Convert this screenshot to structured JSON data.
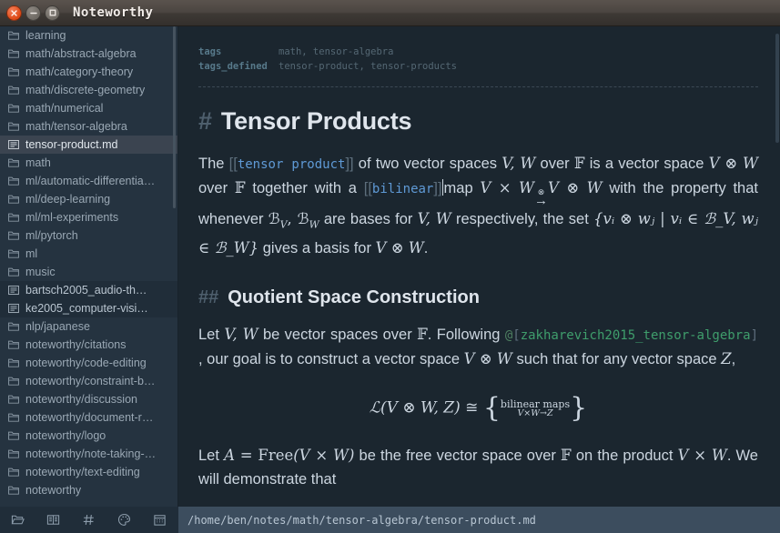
{
  "window": {
    "title": "Noteworthy",
    "controls": [
      {
        "name": "close",
        "glyph": "×"
      },
      {
        "name": "minimize",
        "glyph": "−"
      },
      {
        "name": "maximize",
        "glyph": "□"
      }
    ]
  },
  "sidebar": {
    "items": [
      {
        "label": "learning",
        "icon": "folder-icon",
        "type": "folder",
        "selected": false
      },
      {
        "label": "math/abstract-algebra",
        "icon": "folder-icon",
        "type": "folder",
        "selected": false
      },
      {
        "label": "math/category-theory",
        "icon": "folder-icon",
        "type": "folder",
        "selected": false
      },
      {
        "label": "math/discrete-geometry",
        "icon": "folder-icon",
        "type": "folder",
        "selected": false
      },
      {
        "label": "math/numerical",
        "icon": "folder-icon",
        "type": "folder",
        "selected": false
      },
      {
        "label": "math/tensor-algebra",
        "icon": "folder-icon",
        "type": "folder",
        "selected": false
      },
      {
        "label": "tensor-product.md",
        "icon": "note-icon",
        "type": "note",
        "selected": true
      },
      {
        "label": "math",
        "icon": "folder-icon",
        "type": "folder",
        "selected": false
      },
      {
        "label": "ml/automatic-differentia…",
        "icon": "folder-icon",
        "type": "folder",
        "selected": false
      },
      {
        "label": "ml/deep-learning",
        "icon": "folder-icon",
        "type": "folder",
        "selected": false
      },
      {
        "label": "ml/ml-experiments",
        "icon": "folder-icon",
        "type": "folder",
        "selected": false
      },
      {
        "label": "ml/pytorch",
        "icon": "folder-icon",
        "type": "folder",
        "selected": false
      },
      {
        "label": "ml",
        "icon": "folder-icon",
        "type": "folder",
        "selected": false
      },
      {
        "label": "music",
        "icon": "folder-icon",
        "type": "folder",
        "selected": false
      },
      {
        "label": "bartsch2005_audio-th…",
        "icon": "note-icon",
        "type": "note",
        "selected": false
      },
      {
        "label": "ke2005_computer-visi…",
        "icon": "note-icon",
        "type": "note",
        "selected": false
      },
      {
        "label": "nlp/japanese",
        "icon": "folder-icon",
        "type": "folder",
        "selected": false
      },
      {
        "label": "noteworthy/citations",
        "icon": "folder-icon",
        "type": "folder",
        "selected": false
      },
      {
        "label": "noteworthy/code-editing",
        "icon": "folder-icon",
        "type": "folder",
        "selected": false
      },
      {
        "label": "noteworthy/constraint-b…",
        "icon": "folder-icon",
        "type": "folder",
        "selected": false
      },
      {
        "label": "noteworthy/discussion",
        "icon": "folder-icon",
        "type": "folder",
        "selected": false
      },
      {
        "label": "noteworthy/document-r…",
        "icon": "folder-icon",
        "type": "folder",
        "selected": false
      },
      {
        "label": "noteworthy/logo",
        "icon": "folder-icon",
        "type": "folder",
        "selected": false
      },
      {
        "label": "noteworthy/note-taking-…",
        "icon": "folder-icon",
        "type": "folder",
        "selected": false
      },
      {
        "label": "noteworthy/text-editing",
        "icon": "folder-icon",
        "type": "folder",
        "selected": false
      },
      {
        "label": "noteworthy",
        "icon": "folder-icon",
        "type": "folder",
        "selected": false
      }
    ]
  },
  "document": {
    "frontmatter": [
      {
        "key": "tags",
        "value": "math, tensor-algebra"
      },
      {
        "key": "tags_defined",
        "value": "tensor-product, tensor-products"
      }
    ],
    "h1_marker": "#",
    "h1": "Tensor Products",
    "h2_marker": "##",
    "h2": "Quotient Space Construction",
    "p1": {
      "t1": "The ",
      "link1_open": "[[",
      "link1": "tensor product",
      "link1_close": "]]",
      "t2": " of two vector spaces ",
      "m1": "V, W",
      "t3": " over ",
      "m2": "𝔽",
      "t4": " is a vector space ",
      "m3": "V ⊗ W",
      "t5": " over ",
      "m4": "𝔽",
      "t6": " together with a ",
      "link2_open": "[[",
      "link2": "bilinear",
      "link2_close": "]]",
      "t7": "map ",
      "m5": "V × W",
      "arrow_label": "⊗",
      "arrow": "→",
      "m6": "V ⊗ W",
      "t8": " with the property that whenever ",
      "m7": "ℬ",
      "m7sub": "V",
      "m7b": ", ℬ",
      "m7bsub": "W",
      "t9": " are bases for ",
      "m8": "V, W",
      "t10": " respectively, the set ",
      "set": "{vᵢ ⊗ wⱼ | vᵢ ∈ ℬ_V, wⱼ ∈ ℬ_W}",
      "t11": " gives a basis for ",
      "m9": "V ⊗ W",
      "t12": "."
    },
    "p2": {
      "t1": "Let ",
      "m1": "V, W",
      "t2": " be vector spaces over ",
      "m2": "𝔽",
      "t3": ". Following ",
      "cite_at": "@",
      "cite_open": "[",
      "cite_key": "zakharevich2015_tensor-algebra",
      "cite_close": "]",
      "t4": " , our goal is to construct a vector space ",
      "m3": "V ⊗ W",
      "t5": " such that for any vector space ",
      "m4": "Z",
      "t6": ","
    },
    "display_math": {
      "lhs": "ℒ(V ⊗ W, Z)",
      "rel": "≅",
      "brace_open": "{",
      "rhs_top": "bilinear maps",
      "rhs_bot": "V×W→Z",
      "brace_close": "}"
    },
    "p3": {
      "t1": "Let ",
      "m1": "A = ",
      "free": "Free",
      "m2": "(V × W)",
      "t2": " be the free vector space over ",
      "m3": "𝔽",
      "t3": " on the product ",
      "m4": "V × W",
      "t4": ". We will demonstrate that"
    }
  },
  "statusbar": {
    "buttons": [
      {
        "name": "folder-open-icon",
        "label": "Files"
      },
      {
        "name": "book-icon",
        "label": "Library"
      },
      {
        "name": "hash-icon",
        "label": "Tags"
      },
      {
        "name": "palette-icon",
        "label": "Theme"
      },
      {
        "name": "calendar-icon",
        "label": "Calendar"
      }
    ],
    "path": "/home/ben/notes/math/tensor-algebra/tensor-product.md"
  },
  "colors": {
    "window_bg": "#1b262f",
    "sidebar_bg": "#253340",
    "sidebar_selected": "#3b4450",
    "accent_link": "#5f9ad6",
    "accent_cite": "#3f9e6c",
    "status_path_bg": "#3c4d5e",
    "titlebar_close": "#dd4814"
  }
}
